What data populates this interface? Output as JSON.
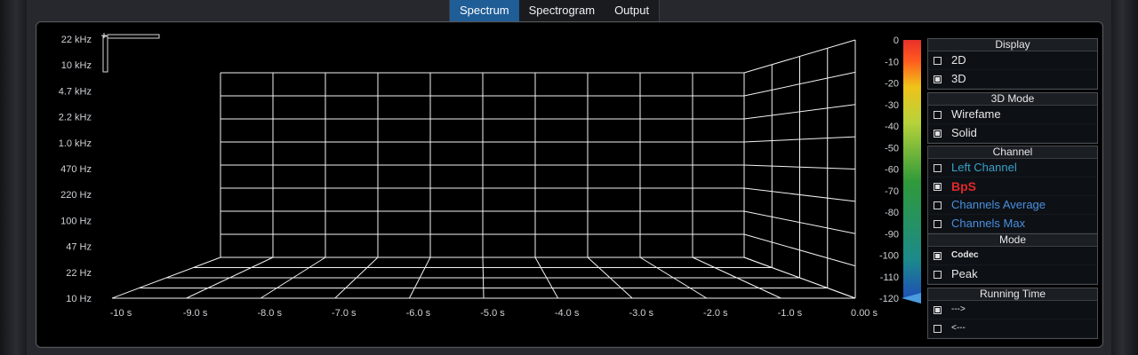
{
  "tabs": [
    {
      "label": "Spectrum",
      "active": true
    },
    {
      "label": "Spectrogram",
      "active": false
    },
    {
      "label": "Output",
      "active": false
    }
  ],
  "plot": {
    "y_ticks": [
      "22 kHz",
      "10 kHz",
      "4.7 kHz",
      "2.2 kHz",
      "1.0 kHz",
      "470 Hz",
      "220 Hz",
      "100 Hz",
      "47 Hz",
      "22 Hz",
      "10 Hz"
    ],
    "x_ticks": [
      "-10 s",
      "-9.0 s",
      "-8.0 s",
      "-7.0 s",
      "-6.0 s",
      "-5.0 s",
      "-4.0 s",
      "-3.0 s",
      "-2.0 s",
      "-1.0 s",
      "0.00 s"
    ],
    "db_ticks": [
      "0",
      "-10",
      "-20",
      "-30",
      "-40",
      "-50",
      "-60",
      "-70",
      "-80",
      "-90",
      "-100",
      "-110",
      "-120"
    ],
    "level_marker_db": -120,
    "colors": {
      "grid": "#f2f2f2",
      "meter_top": "#e8302a",
      "meter_mid": "#2f9a3a",
      "meter_bottom": "#1e4fb8",
      "marker": "#4a9be0"
    }
  },
  "controls": {
    "display": {
      "title": "Display",
      "options": [
        {
          "label": "2D",
          "checked": false
        },
        {
          "label": "3D",
          "checked": true
        }
      ]
    },
    "mode3d": {
      "title": "3D Mode",
      "options": [
        {
          "label": "Wirefame",
          "checked": false
        },
        {
          "label": "Solid",
          "checked": true
        }
      ]
    },
    "channel": {
      "title": "Channel",
      "options": [
        {
          "label": "Left Channel",
          "checked": false,
          "color": "#3aa0c8"
        },
        {
          "label": "BpS",
          "checked": true,
          "color": "#e0282a"
        },
        {
          "label": "Channels Average",
          "checked": false,
          "color": "#4a8fe0"
        },
        {
          "label": "Channels Max",
          "checked": false,
          "color": "#4a8fe0"
        }
      ]
    },
    "mode": {
      "title": "Mode",
      "options": [
        {
          "label": "Codec",
          "checked": true
        },
        {
          "label": "Peak",
          "checked": false
        }
      ]
    },
    "running": {
      "title": "Running Time",
      "options": [
        {
          "label": "--->",
          "checked": true
        },
        {
          "label": "<---",
          "checked": false
        }
      ]
    }
  }
}
